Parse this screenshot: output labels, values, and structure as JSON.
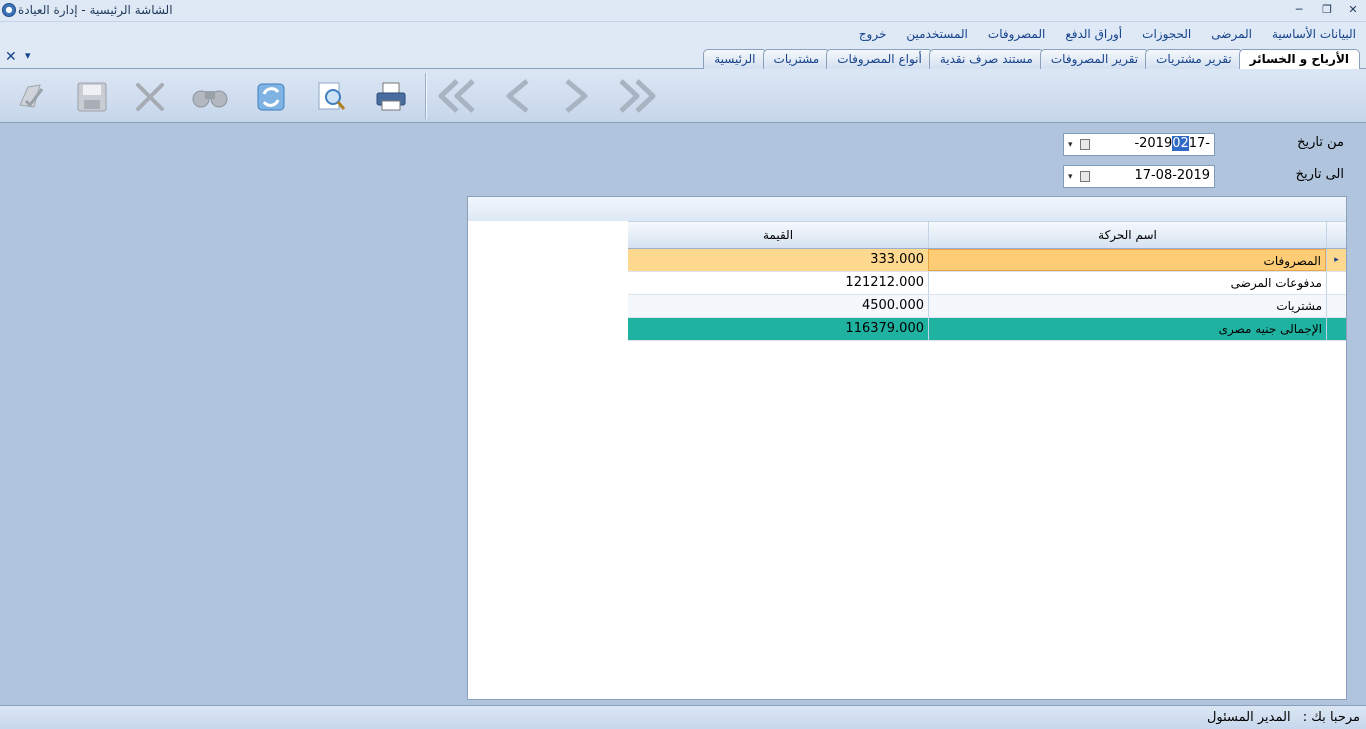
{
  "window": {
    "title": "الشاشة الرئيسية - إدارة العيادة",
    "controls": {
      "minimize": "─",
      "restore": "❐",
      "close": "✕"
    }
  },
  "menu": [
    "البيانات الأساسية",
    "المرضى",
    "الحجوزات",
    "أوراق الدفع",
    "المصروفات",
    "المستخدمين",
    "خروج"
  ],
  "tabs": {
    "items": [
      "الأرباح و الخسائر",
      "تقرير مشتريات",
      "تقرير المصروفات",
      "مستند صرف نقدية",
      "أنواع المصروفات",
      "مشتريات",
      "الرئيسية"
    ],
    "close_glyph": "✕",
    "menu_glyph": "▾"
  },
  "toolbar": {
    "buttons": [
      "approve-icon",
      "save-icon",
      "delete-icon",
      "search-binoculars-icon",
      "refresh-icon",
      "preview-icon",
      "print-icon",
      "first-record-icon",
      "previous-record-icon",
      "next-record-icon",
      "last-record-icon"
    ]
  },
  "filters": {
    "from_label": "من تاريخ",
    "from_day": "17-",
    "from_month": "02",
    "from_year": "-2019",
    "to_label": "الى تاريخ",
    "to_value": "17-08-2019",
    "dropdown_glyph": "▾"
  },
  "grid": {
    "columns": {
      "name": "اسم الحركة",
      "value": "القيمة"
    },
    "rows": [
      {
        "name": "المصروفات",
        "value": "333.000"
      },
      {
        "name": "مدفوعات المرضى",
        "value": "121212.000"
      },
      {
        "name": "مشتريات",
        "value": "4500.000"
      },
      {
        "name": "الإجمالى جنيه مصرى",
        "value": "116379.000"
      }
    ],
    "row_indicator": "▸"
  },
  "status": {
    "welcome": "مرحبا بك :",
    "user": "المدير المسئول"
  },
  "colors": {
    "selected_row": "#ffd88f",
    "total_row": "#20b2a1",
    "chrome": "#dfe9f5",
    "background": "#b0c4de"
  }
}
